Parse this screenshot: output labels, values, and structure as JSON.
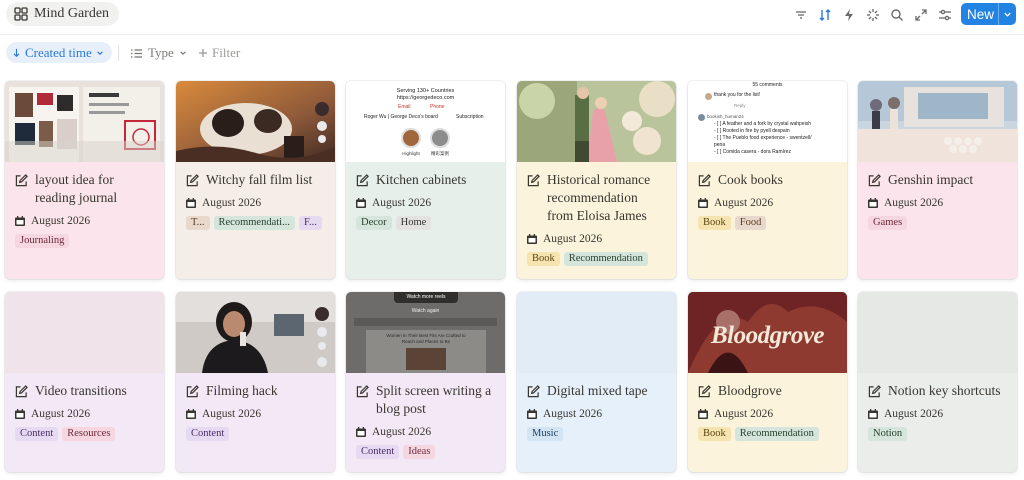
{
  "header": {
    "title": "Mind Garden",
    "new_label": "New",
    "icons": [
      "filter-lines-icon",
      "sort-icon",
      "lightning-icon",
      "sparkle-icon",
      "search-icon",
      "expand-icon",
      "settings-sliders-icon"
    ]
  },
  "toolbar": {
    "sort_label": "Created time",
    "type_label": "Type",
    "filter_label": "Filter"
  },
  "colors": {
    "accent": "#2383e2",
    "sort_pill": "#e7f0fa"
  },
  "cards": [
    {
      "title": "layout idea for reading journal",
      "date": "August 2026",
      "tags": [
        "Journaling"
      ]
    },
    {
      "title": "Witchy fall film list",
      "date": "August 2026",
      "tags": [
        "T...",
        "Recommendati...",
        "F..."
      ]
    },
    {
      "title": "Kitchen cabinets",
      "date": "August 2026",
      "tags": [
        "Decor",
        "Home"
      ],
      "cover": {
        "line1": "Serving 130+ Countries",
        "line2": "https://georgedeco.com",
        "line3": "Email",
        "line4": "Phone",
        "line5": "Roger Wu | George Deco's board",
        "line6": "Subscription",
        "cap1": "Highlight",
        "cap2": "精彩案例"
      }
    },
    {
      "title": "Historical romance recommendation from Eloisa James",
      "date": "August 2026",
      "tags": [
        "Book",
        "Recommendation"
      ]
    },
    {
      "title": "Cook books",
      "date": "August 2026",
      "tags": [
        "Book",
        "Food"
      ],
      "cover": {
        "head": "55 comments",
        "l1": "thank you for the list!",
        "l2": "Reply",
        "l3": "bookish_human24",
        "l4": "- [ ] A feather and a fork by crystal wahpeish",
        "l5": "- [ ] Rooted in fire by pyell despain",
        "l6": "- [ ] The Pueblo food experience - swentzell/",
        "l7": "pena",
        "l8": "- [ ] Comida casera - dora Ramírez"
      }
    },
    {
      "title": "Genshin impact",
      "date": "August 2026",
      "tags": [
        "Games"
      ]
    },
    {
      "title": "Video transitions",
      "date": "August 2026",
      "tags": [
        "Content",
        "Resources"
      ]
    },
    {
      "title": "Filming hack",
      "date": "August 2026",
      "tags": [
        "Content"
      ]
    },
    {
      "title": "Split screen writing a blog post",
      "date": "August 2026",
      "tags": [
        "Content",
        "Ideas"
      ],
      "cover": {
        "top": "Watch more reels",
        "mid": "Watch again",
        "doc": "Women in Their Best Fits Are Crafted to Reach and Places to Be"
      }
    },
    {
      "title": "Digital mixed tape",
      "date": "August 2026",
      "tags": [
        "Music"
      ]
    },
    {
      "title": "Bloodgrove",
      "date": "August 2026",
      "tags": [
        "Book",
        "Recommendation"
      ],
      "cover": {
        "word": "Bloodgrove"
      }
    },
    {
      "title": "Notion key shortcuts",
      "date": "August 2026",
      "tags": [
        "Notion"
      ]
    }
  ]
}
